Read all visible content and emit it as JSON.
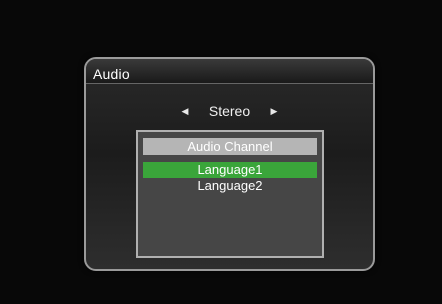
{
  "dialog": {
    "title": "Audio",
    "mode_selector": {
      "value": "Stereo",
      "left_arrow_icon": "triangle-left-icon",
      "right_arrow_icon": "triangle-right-icon"
    },
    "channel_panel": {
      "header": "Audio Channel",
      "items": [
        {
          "label": "Language1",
          "selected": true
        },
        {
          "label": "Language2",
          "selected": false
        }
      ]
    }
  },
  "colors": {
    "selection": "#3aa53a",
    "panel_header": "#b5b5b5",
    "panel_background": "#464646",
    "dialog_border": "#9a9a9a",
    "text": "#ffffff"
  }
}
